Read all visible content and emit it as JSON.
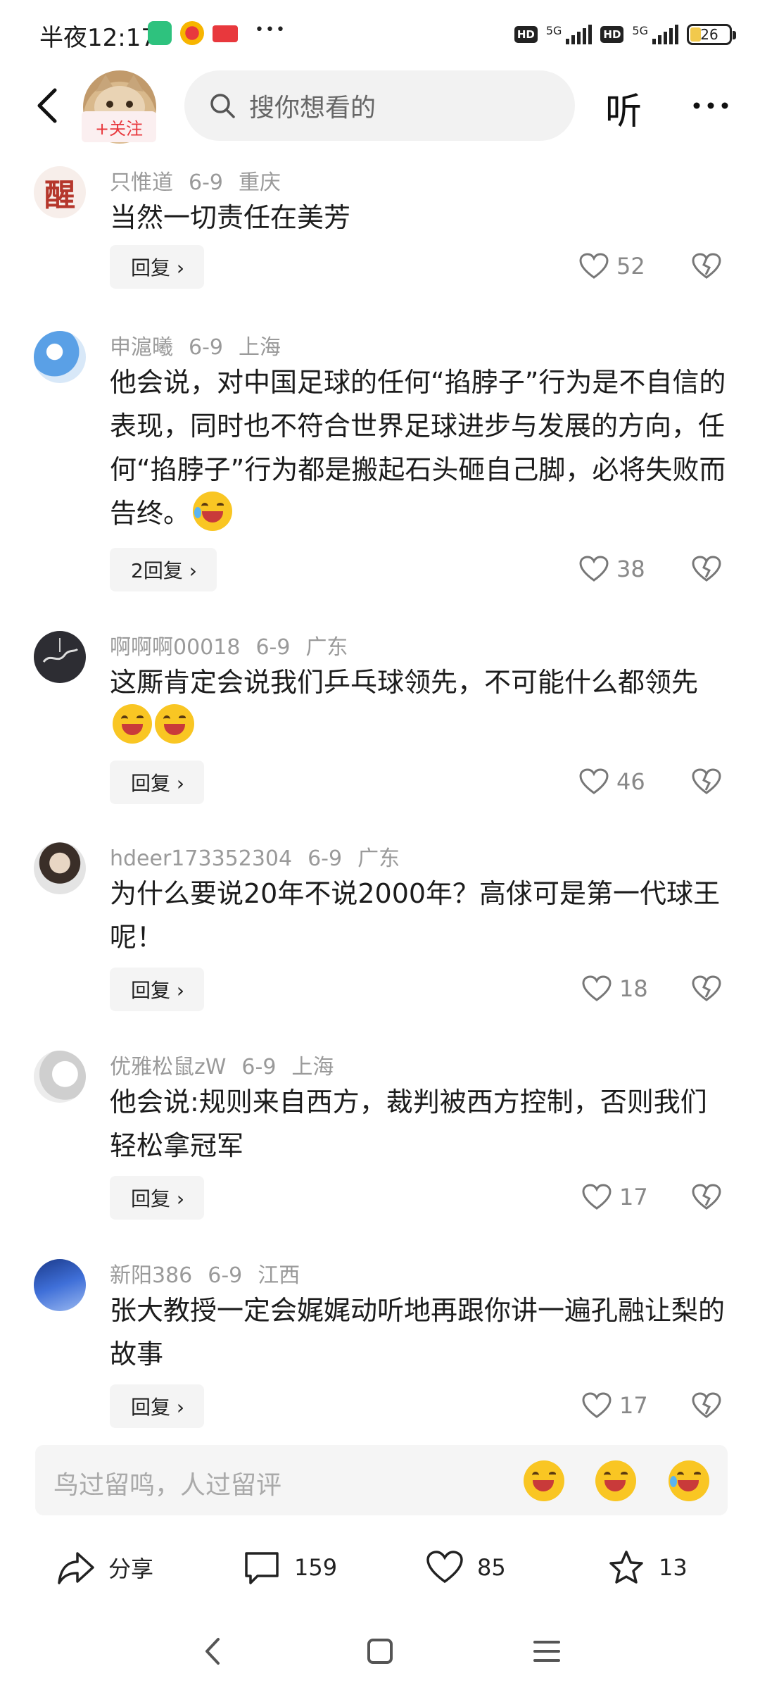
{
  "status_bar": {
    "time": "半夜12:17",
    "network_left": "5G",
    "network_right": "5G",
    "hd_left": "HD",
    "hd_right": "HD",
    "battery": "26",
    "more_dots": "•••"
  },
  "top_nav": {
    "follow_label": "+关注",
    "search_placeholder": "搜你想看的",
    "listen_label": "听"
  },
  "comments": [
    {
      "user": "只惟道",
      "date": "6-9",
      "location": "重庆",
      "text": "当然一切责任在美芳",
      "reply_label": "回复 ›",
      "likes": "52",
      "avatar_char": "醒"
    },
    {
      "user": "申滬曦",
      "date": "6-9",
      "location": "上海",
      "text": "他会说，对中国足球的任何“掐脖子”行为是不自信的表现，同时也不符合世界足球进步与发展的方向，任何“掐脖子”行为都是搬起石头砸自己脚，必将失败而告终。",
      "reply_label": "2回复 ›",
      "likes": "38"
    },
    {
      "user": "啊啊啊00018",
      "date": "6-9",
      "location": "广东",
      "text": "这厮肯定会说我们乒乓球领先，不可能什么都领先",
      "reply_label": "回复 ›",
      "likes": "46"
    },
    {
      "user": "hdeer173352304",
      "date": "6-9",
      "location": "广东",
      "text": "为什么要说20年不说2000年？高俅可是第一代球王呢！",
      "reply_label": "回复 ›",
      "likes": "18"
    },
    {
      "user": "优雅松鼠zW",
      "date": "6-9",
      "location": "上海",
      "text": "他会说:规则来自西方，裁判被西方控制，否则我们轻松拿冠军",
      "reply_label": "回复 ›",
      "likes": "17"
    },
    {
      "user": "新阳386",
      "date": "6-9",
      "location": "江西",
      "text": "张大教授一定会娓娓动听地再跟你讲一遍孔融让梨的故事",
      "reply_label": "回复 ›",
      "likes": "17"
    }
  ],
  "input_bar": {
    "placeholder": "鸟过留鸣，人过留评"
  },
  "actions": {
    "share_label": "分享",
    "comments_count": "159",
    "likes_count": "85",
    "favorites_count": "13"
  },
  "colors": {
    "accent_red": "#e8383d",
    "meta_gray": "#9a9a9a",
    "reply_bg": "#f4f4f4"
  }
}
